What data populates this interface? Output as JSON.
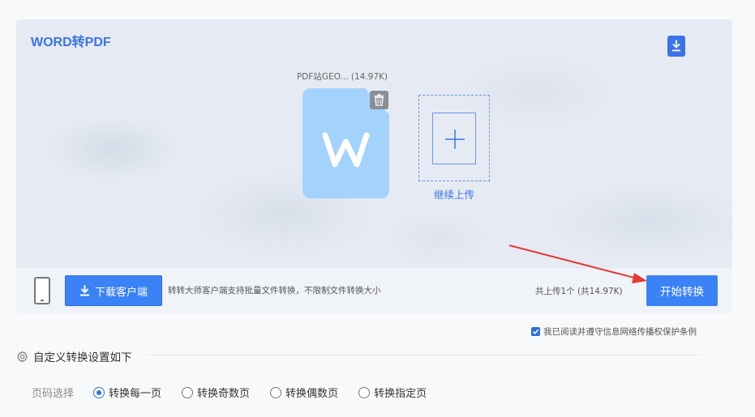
{
  "panel": {
    "title": "WORD转PDF",
    "file_name": "PDF站GEO... (14.97K)",
    "add_label": "继续上传"
  },
  "bar": {
    "download_label": "下载客户端",
    "description": "转转大师客户端支持批量文件转换，不限制文件转换大小",
    "count": "共上传1个  (共14.97K)",
    "start_label": "开始转换"
  },
  "agreement": {
    "text": "我已阅读并遵守信息网络传播权保护条例",
    "checked": true
  },
  "settings": {
    "heading": "自定义转换设置如下",
    "page_label": "页码选择",
    "options": [
      {
        "label": "转换每一页",
        "selected": true
      },
      {
        "label": "转换奇数页",
        "selected": false
      },
      {
        "label": "转换偶数页",
        "selected": false
      },
      {
        "label": "转换指定页",
        "selected": false
      }
    ]
  },
  "colors": {
    "accent": "#3b82f6",
    "file_icon": "#a3d3fd",
    "arrow": "#e53935"
  },
  "icons": {
    "top_download": "download-icon",
    "trash": "trash-icon",
    "add": "plus-icon",
    "phone": "phone-icon",
    "gear": "gear-icon",
    "word": "word-file-icon"
  }
}
